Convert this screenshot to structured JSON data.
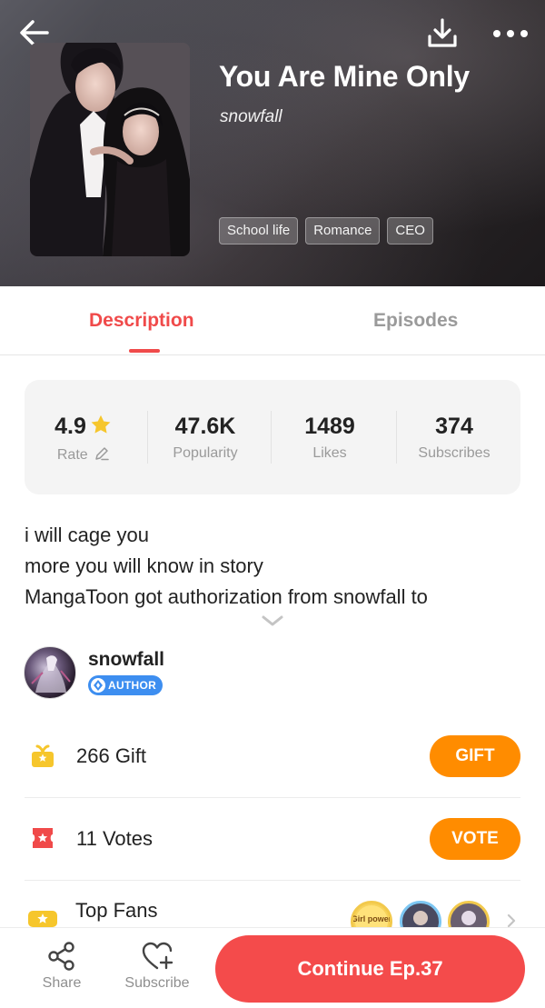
{
  "header": {
    "title": "You Are Mine Only",
    "author": "snowfall",
    "tags": [
      "School life",
      "Romance",
      "CEO"
    ]
  },
  "tabs": {
    "description": "Description",
    "episodes": "Episodes",
    "active": "Description"
  },
  "stats": {
    "rate": {
      "value": "4.9",
      "label": "Rate"
    },
    "popularity": {
      "value": "47.6K",
      "label": "Popularity"
    },
    "likes": {
      "value": "1489",
      "label": "Likes"
    },
    "subscribes": {
      "value": "374",
      "label": "Subscribes"
    }
  },
  "description": {
    "lines": [
      "i will cage you",
      "more you will know in story",
      "MangaToon got authorization from snowfall to"
    ]
  },
  "author": {
    "name": "snowfall",
    "badge": "AUTHOR"
  },
  "gift": {
    "text": "266 Gift",
    "button": "GIFT"
  },
  "votes": {
    "text": "11 Votes",
    "button": "VOTE"
  },
  "top_fans": {
    "label": "Top Fans",
    "first_fan_badge_text": "Girl power"
  },
  "bottom_bar": {
    "share": "Share",
    "subscribe": "Subscribe",
    "continue": "Continue Ep.37"
  },
  "colors": {
    "accent_red": "#f04a4a",
    "button_orange": "#ff8c00",
    "continue_red": "#f44b4b",
    "author_badge_blue": "#3d8ef0",
    "star_yellow": "#f6c62c"
  }
}
